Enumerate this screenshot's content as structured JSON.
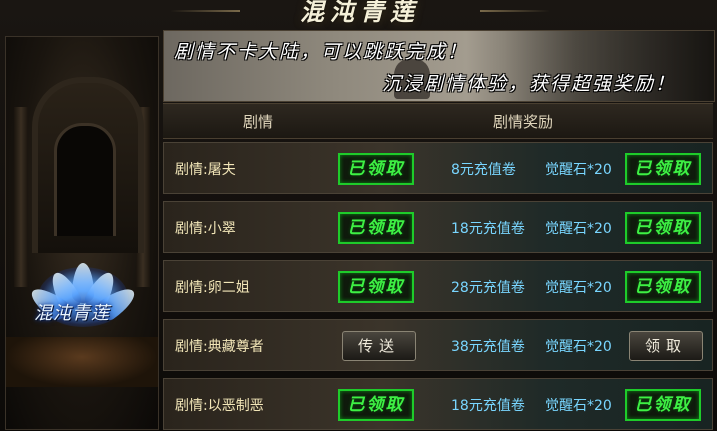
{
  "title": "混沌青莲",
  "left_panel": {
    "lotus_label": "混沌青莲"
  },
  "banner": {
    "line1": "剧情不卡大陆，可以跳跃完成！",
    "line2": "沉浸剧情体验，获得超强奖励！"
  },
  "table": {
    "headers": [
      "剧情",
      "剧情奖励"
    ],
    "rows": [
      {
        "name": "剧情:屠夫",
        "story_action": "已领取",
        "story_action_type": "claimed",
        "reward_1": "8元充值卷",
        "reward_2": "觉醒石*20",
        "reward_action": "已领取",
        "reward_action_type": "claimed"
      },
      {
        "name": "剧情:小翠",
        "story_action": "已领取",
        "story_action_type": "claimed",
        "reward_1": "18元充值卷",
        "reward_2": "觉醒石*20",
        "reward_action": "已领取",
        "reward_action_type": "claimed"
      },
      {
        "name": "剧情:卵二姐",
        "story_action": "已领取",
        "story_action_type": "claimed",
        "reward_1": "28元充值卷",
        "reward_2": "觉醒石*20",
        "reward_action": "已领取",
        "reward_action_type": "claimed"
      },
      {
        "name": "剧情:典藏尊者",
        "story_action": "传送",
        "story_action_type": "button",
        "reward_1": "38元充值卷",
        "reward_2": "觉醒石*20",
        "reward_action": "领取",
        "reward_action_type": "button"
      },
      {
        "name": "剧情:以恶制恶",
        "story_action": "已领取",
        "story_action_type": "claimed",
        "reward_1": "18元充值卷",
        "reward_2": "觉醒石*20",
        "reward_action": "已领取",
        "reward_action_type": "claimed"
      }
    ]
  },
  "colors": {
    "claimed_green": "#3ef044",
    "reward_blue": "#79d6ff",
    "name_gold": "#f2e6b8"
  }
}
